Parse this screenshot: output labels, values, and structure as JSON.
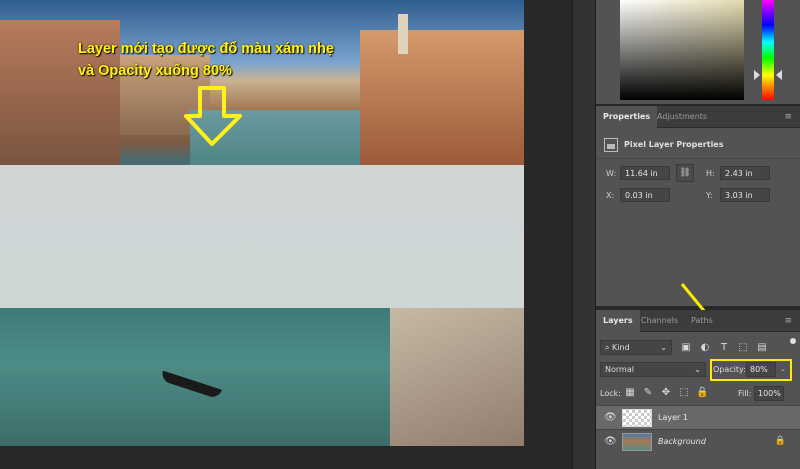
{
  "annotation": {
    "line1": "Layer mới tạo được đổ màu xám nhẹ",
    "line2": "và Opacity xuống 80%"
  },
  "properties": {
    "tabs": [
      {
        "label": "Properties",
        "active": true
      },
      {
        "label": "Adjustments",
        "active": false
      }
    ],
    "title": "Pixel Layer Properties",
    "w_label": "W:",
    "w_value": "11.64 in",
    "h_label": "H:",
    "h_value": "2.43 in",
    "x_label": "X:",
    "x_value": "0.03 in",
    "y_label": "Y:",
    "y_value": "3.03 in"
  },
  "layers": {
    "tabs": [
      {
        "label": "Layers",
        "active": true
      },
      {
        "label": "Channels",
        "active": false
      },
      {
        "label": "Paths",
        "active": false
      }
    ],
    "kind": "Kind",
    "blend_mode": "Normal",
    "opacity_label": "Opacity:",
    "opacity_value": "80%",
    "lock_label": "Lock:",
    "fill_label": "Fill:",
    "fill_value": "100%",
    "items": [
      {
        "name": "Layer 1",
        "selected": true
      },
      {
        "name": "Background",
        "selected": false
      }
    ]
  },
  "colors": {
    "highlight": "#ffeb00",
    "annotation": "#ffef1a",
    "panel": "#535353"
  }
}
